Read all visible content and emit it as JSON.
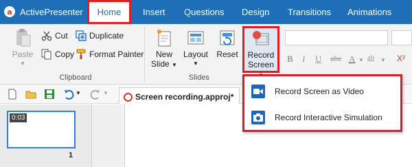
{
  "app": {
    "name": "ActivePresenter"
  },
  "tabs": [
    {
      "label": "Home"
    },
    {
      "label": "Insert"
    },
    {
      "label": "Questions"
    },
    {
      "label": "Design"
    },
    {
      "label": "Transitions"
    },
    {
      "label": "Animations"
    }
  ],
  "clipboard": {
    "paste": "Paste",
    "cut": "Cut",
    "copy": "Copy",
    "duplicate": "Duplicate",
    "format_painter": "Format Painter",
    "group_label": "Clipboard"
  },
  "slides": {
    "new_slide_line1": "New",
    "new_slide_line2": "Slide",
    "layout": "Layout",
    "reset": "Reset",
    "group_label": "Slides"
  },
  "record": {
    "line1": "Record",
    "line2": "Screen"
  },
  "format": {
    "bold": "B",
    "italic": "I",
    "underline": "U",
    "strike": "abc",
    "font_color": "A",
    "highlight": "ab",
    "superscript": "X²"
  },
  "document": {
    "tab_title": "Screen recording.approj*"
  },
  "slide_panel": {
    "duration": "0:03",
    "number": "1"
  },
  "dropdown": {
    "items": [
      {
        "label": "Record Screen as Video",
        "icon": "video-camera-icon"
      },
      {
        "label": "Record Interactive Simulation",
        "icon": "photo-camera-icon"
      }
    ]
  },
  "colors": {
    "tab_bar": "#1f6fb8",
    "highlight_red": "#e41b23",
    "logo_red": "#d43a2a"
  }
}
